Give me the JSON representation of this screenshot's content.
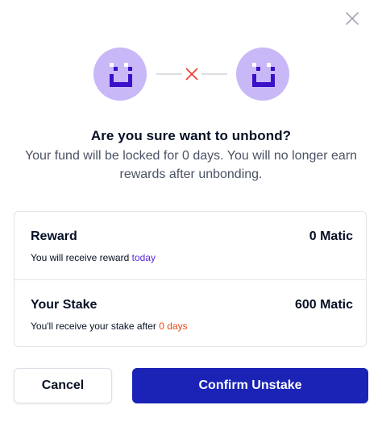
{
  "dialog": {
    "title": "Are you sure want to unbond?",
    "subtitle": "Your fund will be locked for 0 days. You will no longer earn rewards after unbonding.",
    "close_icon": "close-icon"
  },
  "illustration": {
    "left_avatar": "smiley-avatar-icon",
    "right_avatar": "smiley-avatar-icon",
    "connector_icon": "disconnect-x-icon",
    "avatar_color": "#c9b8f8",
    "face_color": "#3b11c8",
    "x_color": "#e83b2e"
  },
  "reward": {
    "label": "Reward",
    "value": "0 Matic",
    "note_prefix": "You will receive reward ",
    "note_highlight": "today"
  },
  "stake": {
    "label": "Your Stake",
    "value": "600 Matic",
    "note_prefix": "You'll receive your stake after ",
    "note_highlight": "0 days"
  },
  "actions": {
    "cancel_label": "Cancel",
    "confirm_label": "Confirm Unstake"
  },
  "colors": {
    "primary": "#1a23b6",
    "highlight_purple": "#5a2bd9",
    "highlight_orange": "#e8460f"
  }
}
